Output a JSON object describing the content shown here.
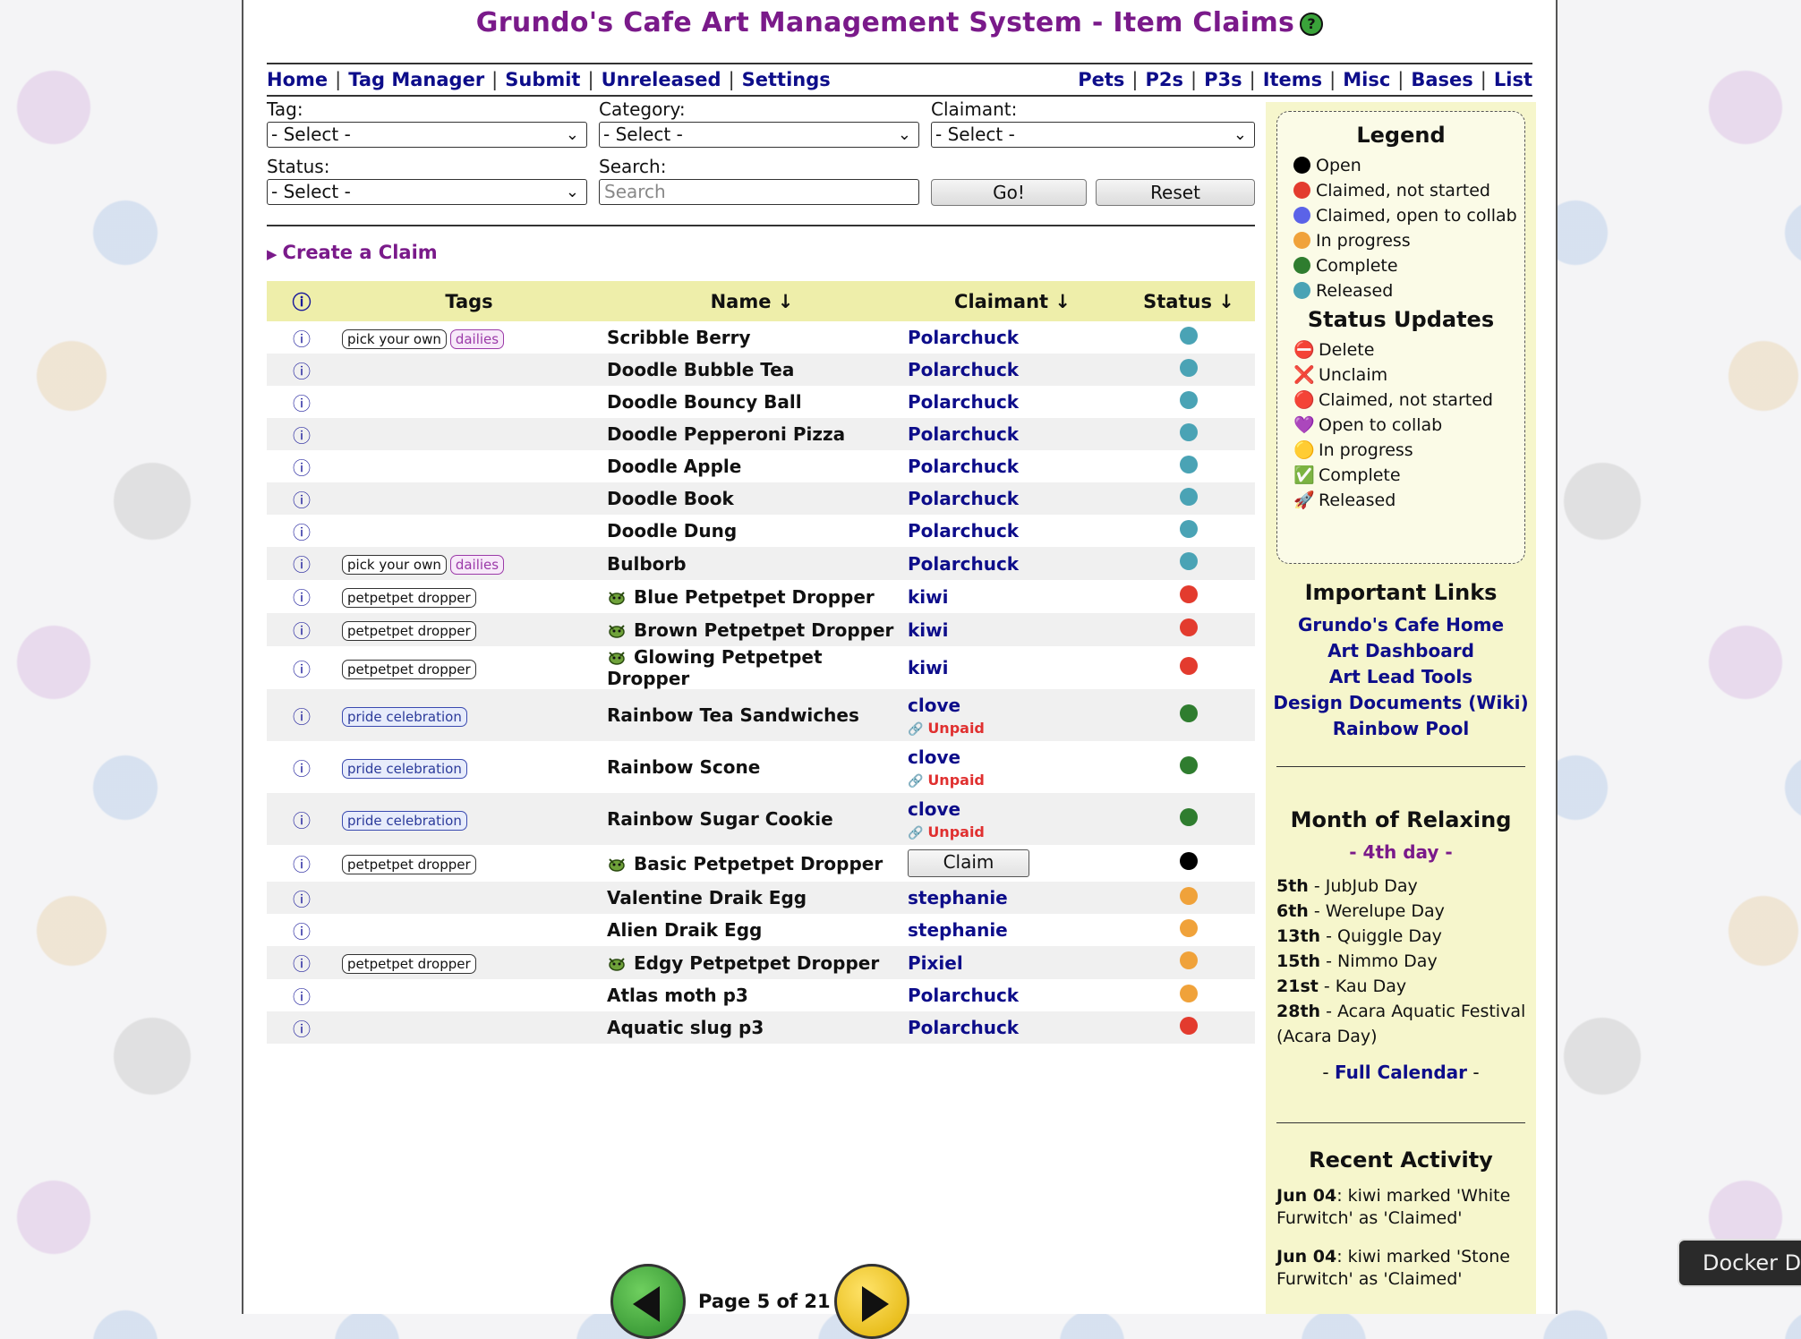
{
  "title": "Grundo's Cafe Art Management System - Item Claims",
  "help_glyph": "?",
  "nav_left": [
    "Home",
    "Tag Manager",
    "Submit",
    "Unreleased",
    "Settings"
  ],
  "nav_right": [
    "Pets",
    "P2s",
    "P3s",
    "Items",
    "Misc",
    "Bases",
    "List"
  ],
  "filters": {
    "tag_label": "Tag:",
    "tag_value": "- Select -",
    "category_label": "Category:",
    "category_value": "- Select -",
    "claimant_label": "Claimant:",
    "claimant_value": "- Select -",
    "status_label": "Status:",
    "status_value": "- Select -",
    "search_label": "Search:",
    "search_placeholder": "Search",
    "go_label": "Go!",
    "reset_label": "Reset"
  },
  "create_claim": "Create a Claim",
  "table": {
    "headers": {
      "info": "ⓘ",
      "tags": "Tags",
      "name": "Name ↓",
      "claimant": "Claimant ↓",
      "status": "Status ↓"
    },
    "rows": [
      {
        "tags": [
          "pick your own",
          "dailies"
        ],
        "name": "Scribble Berry",
        "claimant": "Polarchuck",
        "status": "released"
      },
      {
        "tags": [],
        "name": "Doodle Bubble Tea",
        "claimant": "Polarchuck",
        "status": "released"
      },
      {
        "tags": [],
        "name": "Doodle Bouncy Ball",
        "claimant": "Polarchuck",
        "status": "released"
      },
      {
        "tags": [],
        "name": "Doodle Pepperoni Pizza",
        "claimant": "Polarchuck",
        "status": "released"
      },
      {
        "tags": [],
        "name": "Doodle Apple",
        "claimant": "Polarchuck",
        "status": "released"
      },
      {
        "tags": [],
        "name": "Doodle Book",
        "claimant": "Polarchuck",
        "status": "released"
      },
      {
        "tags": [],
        "name": "Doodle Dung",
        "claimant": "Polarchuck",
        "status": "released"
      },
      {
        "tags": [
          "pick your own",
          "dailies"
        ],
        "name": "Bulborb",
        "claimant": "Polarchuck",
        "status": "released"
      },
      {
        "tags": [
          "petpetpet dropper"
        ],
        "icon": true,
        "name": "Blue Petpetpet Dropper",
        "claimant": "kiwi",
        "status": "claimed"
      },
      {
        "tags": [
          "petpetpet dropper"
        ],
        "icon": true,
        "name": "Brown Petpetpet Dropper",
        "claimant": "kiwi",
        "status": "claimed"
      },
      {
        "tags": [
          "petpetpet dropper"
        ],
        "icon": true,
        "name": "Glowing Petpetpet Dropper",
        "claimant": "kiwi",
        "status": "claimed"
      },
      {
        "tags": [
          "pride celebration"
        ],
        "name": "Rainbow Tea Sandwiches",
        "claimant": "clove",
        "unpaid": "Unpaid",
        "status": "complete"
      },
      {
        "tags": [
          "pride celebration"
        ],
        "name": "Rainbow Scone",
        "claimant": "clove",
        "unpaid": "Unpaid",
        "status": "complete"
      },
      {
        "tags": [
          "pride celebration"
        ],
        "name": "Rainbow Sugar Cookie",
        "claimant": "clove",
        "unpaid": "Unpaid",
        "status": "complete"
      },
      {
        "tags": [
          "petpetpet dropper"
        ],
        "icon": true,
        "name": "Basic Petpetpet Dropper",
        "claim_button": "Claim",
        "status": "open"
      },
      {
        "tags": [],
        "name": "Valentine Draik Egg",
        "claimant": "stephanie",
        "status": "in_progress"
      },
      {
        "tags": [],
        "name": "Alien Draik Egg",
        "claimant": "stephanie",
        "status": "in_progress"
      },
      {
        "tags": [
          "petpetpet dropper"
        ],
        "icon": true,
        "name": "Edgy Petpetpet Dropper",
        "claimant": "Pixiel",
        "status": "in_progress"
      },
      {
        "tags": [],
        "name": "Atlas moth p3",
        "claimant": "Polarchuck",
        "status": "in_progress"
      },
      {
        "tags": [],
        "name": "Aquatic slug p3",
        "claimant": "Polarchuck",
        "status": "claimed"
      }
    ]
  },
  "status_colors": {
    "open": "#000000",
    "claimed": "#e33b2e",
    "collab": "#5b63e8",
    "in_progress": "#f0a23a",
    "complete": "#2f7d2f",
    "released": "#4aa3b5"
  },
  "tag_styles": {
    "dailies": "purple",
    "pride celebration": "blue"
  },
  "pager": {
    "text": "Page 5 of 21"
  },
  "legend": {
    "title": "Legend",
    "items": [
      {
        "key": "open",
        "label": "Open"
      },
      {
        "key": "claimed",
        "label": "Claimed, not started"
      },
      {
        "key": "collab",
        "label": "Claimed, open to collab"
      },
      {
        "key": "in_progress",
        "label": "In progress"
      },
      {
        "key": "complete",
        "label": "Complete"
      },
      {
        "key": "released",
        "label": "Released"
      }
    ],
    "updates_title": "Status Updates",
    "updates": [
      {
        "icon": "⛔",
        "label": "Delete"
      },
      {
        "icon": "❌",
        "label": "Unclaim"
      },
      {
        "icon": "🔴",
        "label": "Claimed, not started"
      },
      {
        "icon": "💜",
        "label": "Open to collab"
      },
      {
        "icon": "🟡",
        "label": "In progress"
      },
      {
        "icon": "✅",
        "label": "Complete"
      },
      {
        "icon": "🚀",
        "label": "Released"
      }
    ]
  },
  "important_links": {
    "title": "Important Links",
    "links": [
      "Grundo's Cafe Home",
      "Art Dashboard",
      "Art Lead Tools",
      "Design Documents (Wiki)",
      "Rainbow Pool"
    ]
  },
  "month": {
    "title": "Month of Relaxing",
    "today": "- 4th day -",
    "events": [
      {
        "day": "5th",
        "name": "JubJub Day"
      },
      {
        "day": "6th",
        "name": "Werelupe Day"
      },
      {
        "day": "13th",
        "name": "Quiggle Day"
      },
      {
        "day": "15th",
        "name": "Nimmo Day"
      },
      {
        "day": "21st",
        "name": "Kau Day"
      },
      {
        "day": "28th",
        "name": "Acara Aquatic Festival (Acara Day)"
      }
    ],
    "calendar_link": "Full Calendar"
  },
  "recent_activity": {
    "title": "Recent Activity",
    "items": [
      {
        "date": "Jun 04",
        "text": "kiwi marked 'White Furwitch' as 'Claimed'"
      },
      {
        "date": "Jun 04",
        "text": "kiwi marked 'Stone Furwitch' as 'Claimed'"
      }
    ]
  },
  "docker_tooltip": "Docker D"
}
